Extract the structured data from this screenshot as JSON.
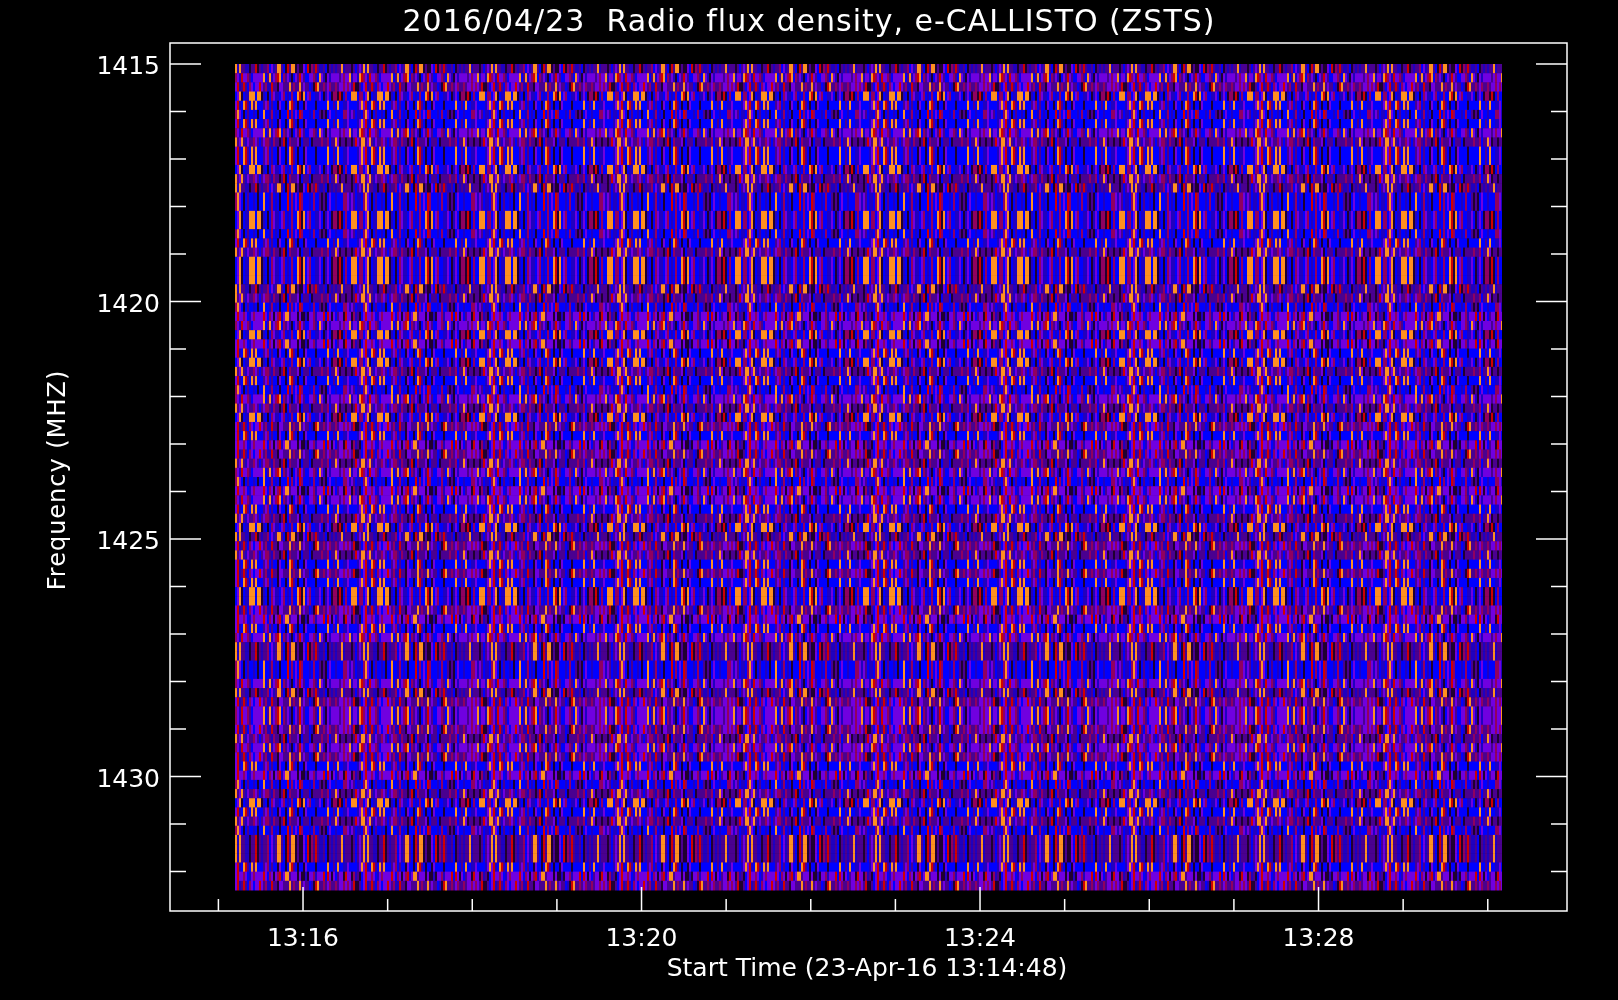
{
  "title": "2016/04/23  Radio flux density, e-CALLISTO (ZSTS)",
  "plot": {
    "ylabel": "Frequency (MHZ)",
    "xlabel": "Start Time (23-Apr-16 13:14:48)",
    "yticks": [
      "1415",
      "1420",
      "1425",
      "1430"
    ],
    "xticks": [
      "13:16",
      "13:20",
      "13:24",
      "13:28"
    ]
  }
}
